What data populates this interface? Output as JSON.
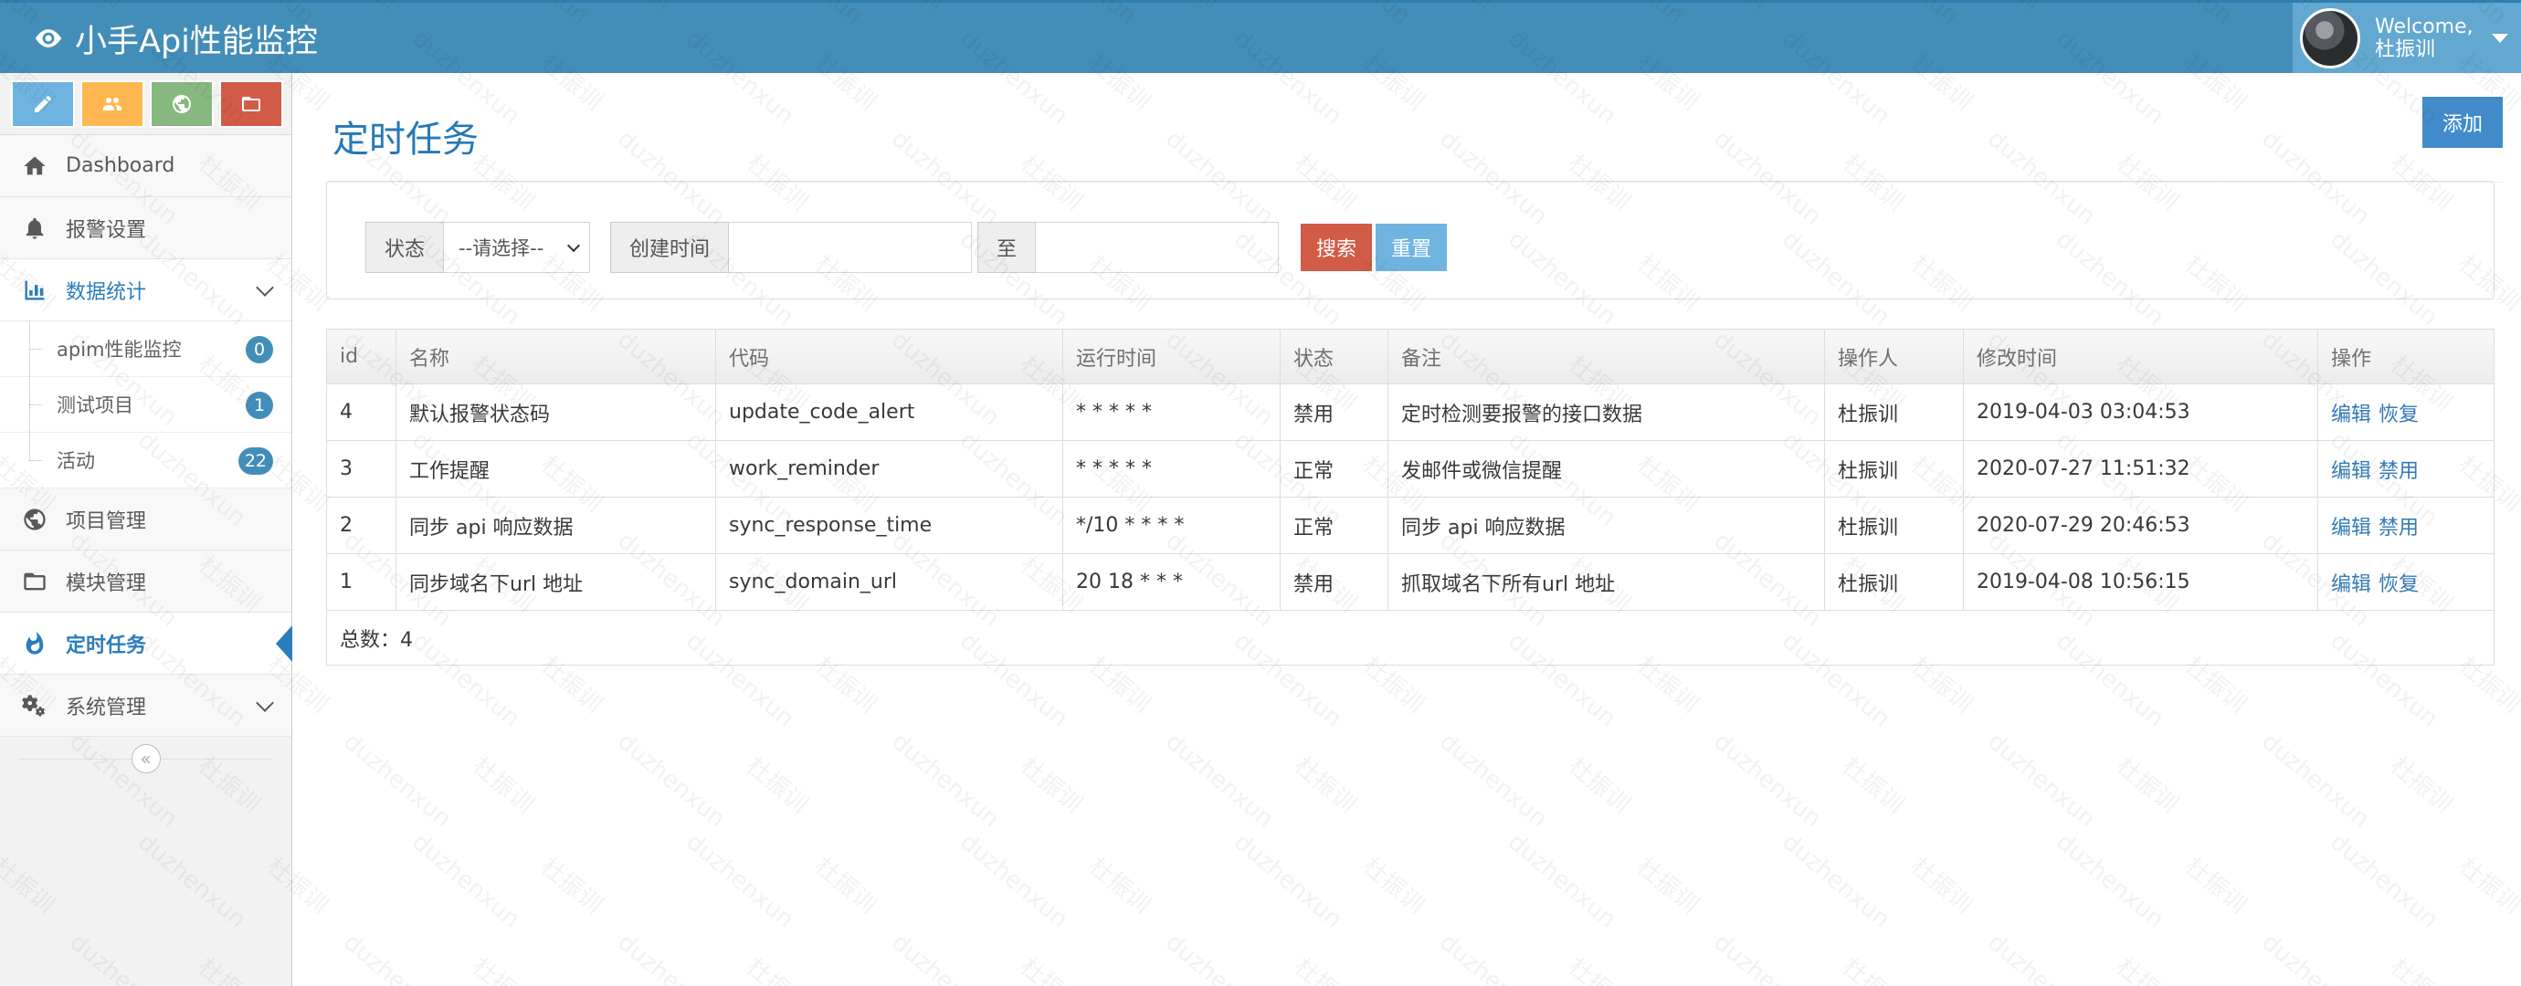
{
  "app": {
    "title": "小手Api性能监控"
  },
  "user": {
    "welcome": "Welcome,",
    "name": "杜振训"
  },
  "sidebar": {
    "shortcuts": [
      {
        "icon": "pencil-icon",
        "color": "#82af6f"
      },
      {
        "icon": "users-icon",
        "color": "#f89406"
      },
      {
        "icon": "globe-icon",
        "color": "#87b87f"
      },
      {
        "icon": "folder-icon",
        "color": "#d15b47"
      }
    ],
    "items": [
      {
        "label": "Dashboard",
        "icon": "home-icon"
      },
      {
        "label": "报警设置",
        "icon": "bell-icon"
      },
      {
        "label": "数据统计",
        "icon": "bar-chart-icon",
        "open": true,
        "children": [
          {
            "label": "apim性能监控",
            "badge": "0"
          },
          {
            "label": "测试项目",
            "badge": "1"
          },
          {
            "label": "活动",
            "badge": "22"
          }
        ]
      },
      {
        "label": "项目管理",
        "icon": "globe-icon"
      },
      {
        "label": "模块管理",
        "icon": "folder-icon"
      },
      {
        "label": "定时任务",
        "icon": "fire-icon",
        "active": true
      },
      {
        "label": "系统管理",
        "icon": "cogs-icon"
      }
    ],
    "collapse_glyph": "«"
  },
  "page": {
    "title": "定时任务",
    "add_label": "添加"
  },
  "search": {
    "status_label": "状态",
    "status_value": "--请选择--",
    "created_label": "创建时间",
    "to_label": "至",
    "search_label": "搜索",
    "reset_label": "重置"
  },
  "table": {
    "columns": [
      "id",
      "名称",
      "代码",
      "运行时间",
      "状态",
      "备注",
      "操作人",
      "修改时间",
      "操作"
    ],
    "rows": [
      {
        "id": "4",
        "name": "默认报警状态码",
        "code": "update_code_alert",
        "cron": "* * * * *",
        "status": "禁用",
        "note": "定时检测要报警的接口数据",
        "operator": "杜振训",
        "modified": "2019-04-03 03:04:53",
        "op1": "编辑",
        "op2": "恢复"
      },
      {
        "id": "3",
        "name": "工作提醒",
        "code": "work_reminder",
        "cron": "* * * * *",
        "status": "正常",
        "note": "发邮件或微信提醒",
        "operator": "杜振训",
        "modified": "2020-07-27 11:51:32",
        "op1": "编辑",
        "op2": "禁用"
      },
      {
        "id": "2",
        "name": "同步 api 响应数据",
        "code": "sync_response_time",
        "cron": "*/10 * * * *",
        "status": "正常",
        "note": "同步 api 响应数据",
        "operator": "杜振训",
        "modified": "2020-07-29 20:46:53",
        "op1": "编辑",
        "op2": "禁用"
      },
      {
        "id": "1",
        "name": "同步域名下url 地址",
        "code": "sync_domain_url",
        "cron": "20 18 * * *",
        "status": "禁用",
        "note": "抓取域名下所有url 地址",
        "operator": "杜振训",
        "modified": "2019-04-08 10:56:15",
        "op1": "编辑",
        "op2": "恢复"
      }
    ],
    "total": "总数：4"
  },
  "watermark": {
    "texts": [
      "duzhenxun",
      "杜振训"
    ]
  }
}
